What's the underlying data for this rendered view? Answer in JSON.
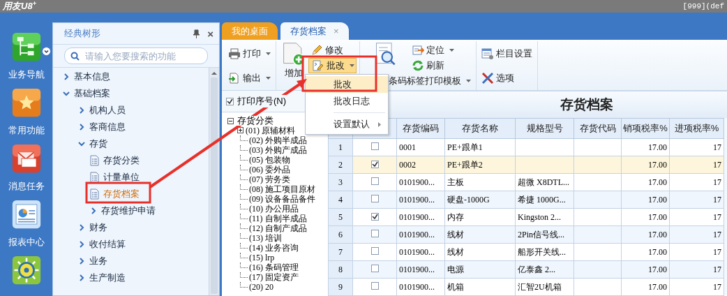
{
  "app_title": "用友U8$^{+}$",
  "account": "[999](def",
  "nav": [
    {
      "label": "业务导航",
      "kind": "tree"
    },
    {
      "label": "常用功能",
      "kind": "star"
    },
    {
      "label": "消息任务",
      "kind": "mail"
    },
    {
      "label": "报表中心",
      "kind": "report"
    },
    {
      "kind": "sun"
    }
  ],
  "tree_panel": {
    "title": "经典树形",
    "close": "×",
    "search": {
      "placeholder": "请输入您要搜索的功能"
    },
    "items": [
      {
        "label": "基本信息",
        "kind": "folder",
        "expanded": false,
        "selected": false
      },
      {
        "label": "基础档案",
        "kind": "folder",
        "expanded": true,
        "selected": false,
        "children": [
          {
            "label": "机构人员",
            "kind": "folder",
            "expanded": false,
            "selected": false
          },
          {
            "label": "客商信息",
            "kind": "folder",
            "expanded": false,
            "selected": false
          },
          {
            "label": "存货",
            "kind": "folder",
            "expanded": true,
            "selected": false,
            "children": [
              {
                "label": "存货分类",
                "kind": "doc",
                "selected": false
              },
              {
                "label": "计量单位",
                "kind": "doc",
                "selected": false
              },
              {
                "label": "存货档案",
                "kind": "doc",
                "selected": true
              },
              {
                "label": "存货维护申请",
                "kind": "folder",
                "expanded": false,
                "selected": false
              }
            ]
          },
          {
            "label": "财务",
            "kind": "folder",
            "expanded": false,
            "selected": false
          },
          {
            "label": "收付结算",
            "kind": "folder",
            "expanded": false,
            "selected": false
          },
          {
            "label": "业务",
            "kind": "folder",
            "expanded": false,
            "selected": false
          },
          {
            "label": "生产制造",
            "kind": "folder",
            "expanded": false,
            "selected": false
          }
        ]
      }
    ]
  },
  "tabs": [
    {
      "label": "我的桌面",
      "selected": false
    },
    {
      "label": "存货档案",
      "selected": true,
      "close": "×"
    }
  ],
  "toolbar": [
    {
      "buttons": [
        {
          "label": "打印",
          "dropdown": true
        },
        {
          "label": "输出",
          "dropdown": true
        }
      ]
    },
    {
      "big": {
        "label": "增加"
      },
      "buttons": [
        {
          "label": "修改",
          "dropdown": false,
          "pressed": false
        },
        {
          "label": "批改",
          "dropdown": true,
          "pressed": true
        }
      ]
    },
    {
      "buttons": [
        {
          "label": "定位",
          "dropdown": true
        },
        {
          "label": "刷新",
          "dropdown": false
        }
      ],
      "wide": {
        "label": "条码标签打印模板",
        "dropdown": true
      }
    },
    {
      "buttons": [
        {
          "label": "栏目设置",
          "dropdown": false
        },
        {
          "label": "选项",
          "dropdown": false
        }
      ]
    }
  ],
  "menu": {
    "items": [
      {
        "kind": "item",
        "label": "批改",
        "selected": true
      },
      {
        "kind": "item",
        "label": "批改日志",
        "selected": false
      },
      {
        "kind": "separator"
      },
      {
        "kind": "submenu",
        "label": "设置默认",
        "selected": false
      }
    ]
  },
  "print_serial": {
    "label": "打印序号(N)",
    "checked": true
  },
  "category_tree": {
    "label": "存货分类",
    "expanded": true,
    "children": [
      {
        "label": "(01) 原辅材料",
        "kind": "node",
        "expanded": false
      },
      {
        "label": "(02) 外购半成品",
        "kind": "leaf"
      },
      {
        "label": "(03) 外购产成品",
        "kind": "leaf"
      },
      {
        "label": "(05) 包装物",
        "kind": "leaf"
      },
      {
        "label": "(06) 委外品",
        "kind": "leaf"
      },
      {
        "label": "(07) 劳务类",
        "kind": "leaf"
      },
      {
        "label": "(08) 施工项目原材",
        "kind": "leaf"
      },
      {
        "label": "(09) 设备备品备件",
        "kind": "leaf"
      },
      {
        "label": "(10) 办公用品",
        "kind": "leaf"
      },
      {
        "label": "(11) 自制半成品",
        "kind": "leaf"
      },
      {
        "label": "(12) 自制产成品",
        "kind": "leaf"
      },
      {
        "label": "(13) 培训",
        "kind": "leaf"
      },
      {
        "label": "(14) 业务咨询",
        "kind": "leaf"
      },
      {
        "label": "(15) lrp",
        "kind": "leaf"
      },
      {
        "label": "(16) 条码管理",
        "kind": "leaf"
      },
      {
        "label": "(17) 固定资产",
        "kind": "leaf"
      },
      {
        "label": "(20) 20",
        "kind": "leaf"
      }
    ]
  },
  "grid": {
    "title": "存货档案",
    "columns": [
      "存货编码",
      "存货名称",
      "规格型号",
      "存货代码",
      "销项税率%",
      "进项税率%"
    ],
    "rows": [
      {
        "no": "1",
        "checked": false,
        "selected": false,
        "code": "0001",
        "name": "PE+跟单1",
        "rate_out": "17.00",
        "rate_in": "17"
      },
      {
        "no": "2",
        "checked": true,
        "selected": true,
        "code": "0002",
        "name": "PE+跟单2",
        "rate_out": "17.00",
        "rate_in": "17"
      },
      {
        "no": "3",
        "checked": false,
        "selected": false,
        "code": "0101900...",
        "name": "主板",
        "spec": "超微 X8DTL...",
        "rate_out": "17.00",
        "rate_in": "17"
      },
      {
        "no": "4",
        "checked": false,
        "selected": false,
        "code": "0101900...",
        "name": "硬盘-1000G",
        "spec": "希捷 1000G...",
        "rate_out": "17.00",
        "rate_in": "17"
      },
      {
        "no": "5",
        "checked": true,
        "selected": false,
        "code": "0101900...",
        "name": "内存",
        "spec": "Kingston 2...",
        "rate_out": "17.00",
        "rate_in": "17"
      },
      {
        "no": "6",
        "checked": false,
        "selected": false,
        "code": "0101900...",
        "name": "线材",
        "spec": "2Pin信号线...",
        "rate_out": "17.00",
        "rate_in": "17"
      },
      {
        "no": "7",
        "checked": false,
        "selected": false,
        "code": "0101900...",
        "name": "线材",
        "spec": "船形开关线...",
        "rate_out": "17.00",
        "rate_in": "17"
      },
      {
        "no": "8",
        "checked": false,
        "selected": false,
        "code": "0101900...",
        "name": "电源",
        "spec": "亿泰鑫 2...",
        "rate_out": "17.00",
        "rate_in": "17"
      },
      {
        "no": "9",
        "checked": false,
        "selected": false,
        "code": "0101900...",
        "name": "机箱",
        "spec": "汇智2U机箱",
        "rate_out": "17.00",
        "rate_in": "17"
      }
    ]
  }
}
